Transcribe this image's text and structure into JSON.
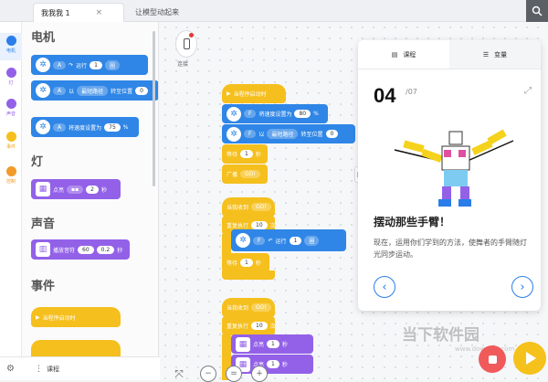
{
  "tabs": [
    {
      "label": "我我我 1",
      "active": true
    },
    {
      "label": "让模型动起来",
      "active": false
    }
  ],
  "topbar": {
    "close_glyph": "×",
    "search_icon": "search-icon"
  },
  "rail": [
    {
      "label": "电机",
      "color": "#2b7de9"
    },
    {
      "label": "灯",
      "color": "#9361e8"
    },
    {
      "label": "声音",
      "color": "#9361e8"
    },
    {
      "label": "事件",
      "color": "#f5bf1d"
    },
    {
      "label": "控制",
      "color": "#f29a2a"
    }
  ],
  "palette": {
    "categories": {
      "motor": "电机",
      "light": "灯",
      "sound": "声音",
      "event": "事件"
    },
    "motor_blocks": {
      "b1": {
        "port": "A",
        "action": "运行",
        "value": "1",
        "unit": "圈"
      },
      "b2": {
        "port": "A",
        "word1": "以",
        "mode": "最短路径",
        "text": "转至位置",
        "value": "0"
      },
      "b3": {
        "port": "A",
        "text": "将速度设置为",
        "value": "75",
        "unit": "%"
      }
    },
    "light_block": {
      "text": "点亮",
      "value": "2",
      "unit": "秒"
    },
    "sound_block": {
      "text": "播放音符",
      "value1": "60",
      "value2": "0.2",
      "unit": "秒"
    },
    "event_block": {
      "text": "当程序启动时"
    },
    "footer_label": "课程"
  },
  "workspace": {
    "device_label": "连接",
    "stack1": {
      "hat": "当程序启动时",
      "b1": {
        "port": "F",
        "text": "将速度设置为",
        "value": "80",
        "unit": "%"
      },
      "b2": {
        "port": "F",
        "word1": "以",
        "mode": "最短路径",
        "text": "转至位置",
        "value": "0"
      },
      "wait": {
        "text": "等待",
        "value": "1",
        "unit": "秒"
      },
      "broadcast": {
        "text": "广播",
        "value": "GO!"
      }
    },
    "stack2": {
      "hat": "当我收到",
      "hat_value": "GO!",
      "repeat": {
        "text": "重复执行",
        "value": "10",
        "unit": "次"
      },
      "inner": {
        "port": "F",
        "action": "运行",
        "value": "1",
        "unit": "圈"
      },
      "wait": {
        "text": "等待",
        "value": "1",
        "unit": "秒"
      }
    },
    "stack3": {
      "hat": "当我收到",
      "hat_value": "GO!",
      "repeat": {
        "text": "重复执行",
        "value": "10",
        "unit": "次"
      },
      "inner1": {
        "text": "点亮",
        "value": "1",
        "unit": "秒"
      },
      "inner2": {
        "text": "点亮",
        "value": "1",
        "unit": "秒"
      }
    }
  },
  "panel": {
    "tab_course": "课程",
    "tab_variables": "变量",
    "step": "04",
    "total": "/07",
    "title": "摆动那些手臂！",
    "text": "现在，运用你们学到的方法，使舞者的手臂随灯光同步运动。"
  },
  "watermark": {
    "main": "当下软件园",
    "sub": "www.downxia.com"
  }
}
